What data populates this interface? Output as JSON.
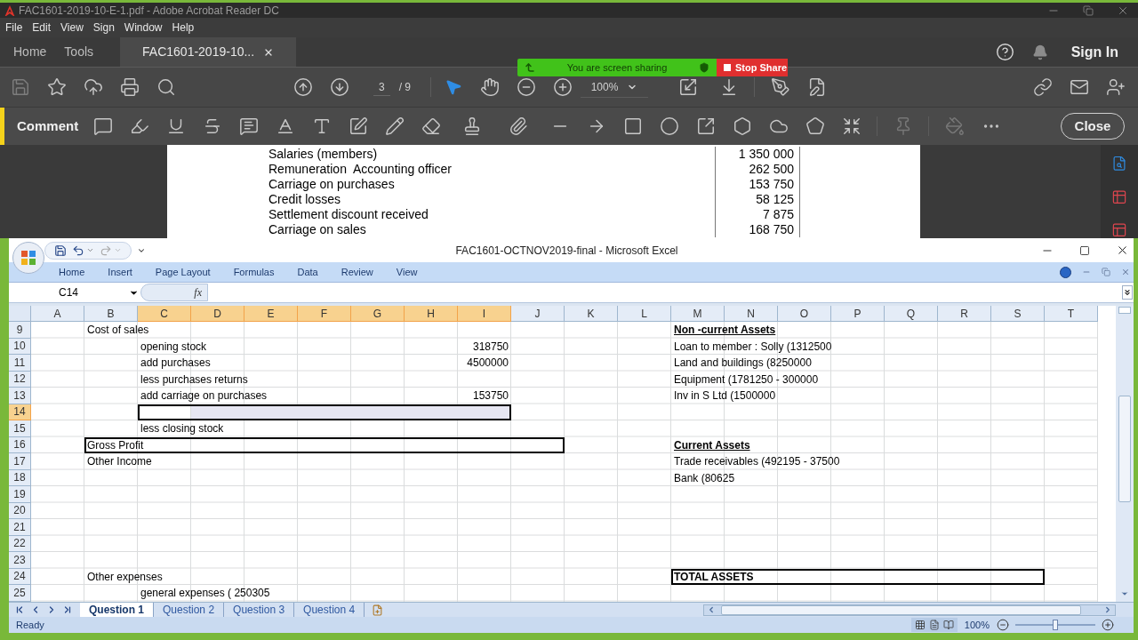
{
  "acrobat": {
    "title": "FAC1601-2019-10-E-1.pdf - Adobe Acrobat Reader DC",
    "menu": [
      "File",
      "Edit",
      "View",
      "Sign",
      "Window",
      "Help"
    ],
    "tabs": [
      {
        "label": "Home",
        "selected": false
      },
      {
        "label": "Tools",
        "selected": false
      },
      {
        "label": "FAC1601-2019-10...",
        "selected": true
      }
    ],
    "sign_in": "Sign In",
    "page_current": "3",
    "page_total": "/ 9",
    "zoom": "100%",
    "comment_label": "Comment",
    "close_button": "Close",
    "document_lines": [
      {
        "label": "Salaries (members)",
        "amount": "1 350 000"
      },
      {
        "label": "Remuneration  Accounting officer",
        "amount": "262 500"
      },
      {
        "label": "Carriage on purchases",
        "amount": "153 750"
      },
      {
        "label": "Credit losses",
        "amount": "58 125"
      },
      {
        "label": "Settlement discount received",
        "amount": "7 875"
      },
      {
        "label": "Carriage on sales",
        "amount": "168 750"
      }
    ]
  },
  "screen_share": {
    "status": "You are screen sharing",
    "stop": "Stop Share"
  },
  "excel": {
    "title": "FAC1601-OCTNOV2019-final - Microsoft Excel",
    "ribbon_tabs": [
      "Home",
      "Insert",
      "Page Layout",
      "Formulas",
      "Data",
      "Review",
      "View"
    ],
    "name_box": "C14",
    "formula_label": "fx",
    "columns": [
      {
        "label": "A",
        "selected": false
      },
      {
        "label": "B",
        "selected": false
      },
      {
        "label": "C",
        "selected": true
      },
      {
        "label": "D",
        "selected": true
      },
      {
        "label": "E",
        "selected": true
      },
      {
        "label": "F",
        "selected": true
      },
      {
        "label": "G",
        "selected": true
      },
      {
        "label": "H",
        "selected": true
      },
      {
        "label": "I",
        "selected": true
      },
      {
        "label": "J",
        "selected": false
      },
      {
        "label": "K",
        "selected": false
      },
      {
        "label": "L",
        "selected": false
      },
      {
        "label": "M",
        "selected": false
      },
      {
        "label": "N",
        "selected": false
      },
      {
        "label": "O",
        "selected": false
      },
      {
        "label": "P",
        "selected": false
      },
      {
        "label": "Q",
        "selected": false
      },
      {
        "label": "R",
        "selected": false
      },
      {
        "label": "S",
        "selected": false
      },
      {
        "label": "T",
        "selected": false
      }
    ],
    "rows": [
      {
        "label": "9",
        "selected": false,
        "cells": {
          "b": {
            "kind": "text",
            "text": "Cost of sales"
          },
          "m": {
            "kind": "heading",
            "text": "Non -current Assets"
          }
        }
      },
      {
        "label": "10",
        "selected": false,
        "cells": {
          "c": {
            "kind": "text",
            "text": "opening stock"
          },
          "i": {
            "kind": "number",
            "text": "318750"
          },
          "m": {
            "kind": "text",
            "text": "Loan to member : Solly (1312500"
          }
        }
      },
      {
        "label": "11",
        "selected": false,
        "cells": {
          "c": {
            "kind": "text",
            "text": "add purchases"
          },
          "i": {
            "kind": "number",
            "text": "4500000"
          },
          "m": {
            "kind": "text",
            "text": "Land and buildings (8250000"
          }
        }
      },
      {
        "label": "12",
        "selected": false,
        "cells": {
          "c": {
            "kind": "text",
            "text": "less purchases returns"
          },
          "m": {
            "kind": "text",
            "text": "Equipment (1781250 - 300000"
          }
        }
      },
      {
        "label": "13",
        "selected": false,
        "cells": {
          "c": {
            "kind": "text",
            "text": "add carriage on purchases"
          },
          "i": {
            "kind": "number",
            "text": "153750"
          },
          "m": {
            "kind": "text",
            "text": "Inv in S Ltd (1500000"
          }
        }
      },
      {
        "label": "14",
        "selected": true
      },
      {
        "label": "15",
        "selected": false,
        "cells": {
          "c": {
            "kind": "text",
            "text": "less closing stock"
          }
        }
      },
      {
        "label": "16",
        "selected": false,
        "cells": {
          "b": {
            "kind": "text",
            "text": "Gross Profit",
            "boxed": true
          },
          "m": {
            "kind": "heading",
            "text": "Current Assets"
          }
        }
      },
      {
        "label": "17",
        "selected": false,
        "cells": {
          "b": {
            "kind": "text",
            "text": "Other Income"
          },
          "m": {
            "kind": "text",
            "text": "Trade receivables (492195 - 37500"
          }
        }
      },
      {
        "label": "18",
        "selected": false,
        "cells": {
          "m": {
            "kind": "text",
            "text": "Bank (80625"
          }
        }
      },
      {
        "label": "19",
        "selected": false
      },
      {
        "label": "20",
        "selected": false
      },
      {
        "label": "21",
        "selected": false
      },
      {
        "label": "22",
        "selected": false
      },
      {
        "label": "23",
        "selected": false
      },
      {
        "label": "24",
        "selected": false,
        "cells": {
          "b": {
            "kind": "text",
            "text": "Other expenses"
          },
          "m": {
            "kind": "total",
            "text": "TOTAL ASSETS",
            "boxed": true
          }
        }
      },
      {
        "label": "25",
        "selected": false,
        "cells": {
          "c": {
            "kind": "text",
            "text": "general expenses ( 250305"
          }
        }
      }
    ],
    "sheet_tabs": [
      {
        "label": "Question 1",
        "selected": true
      },
      {
        "label": "Question 2",
        "selected": false
      },
      {
        "label": "Question 3",
        "selected": false
      },
      {
        "label": "Question 4",
        "selected": false
      }
    ],
    "status": "Ready",
    "zoom": "100%",
    "zoom_slider": {
      "level": 0.5
    }
  }
}
